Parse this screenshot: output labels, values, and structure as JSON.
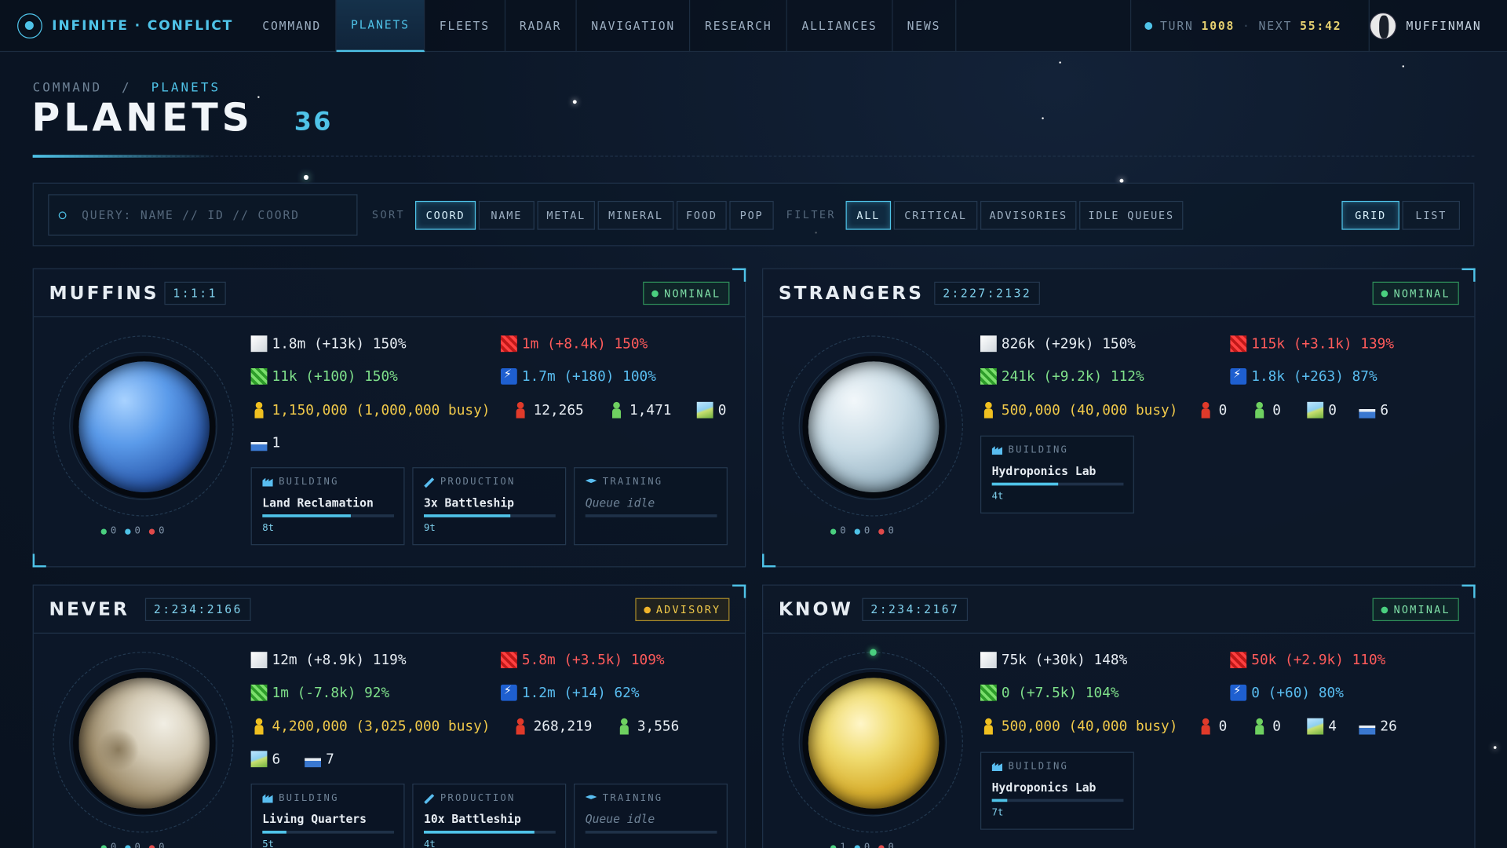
{
  "app": {
    "title": "INFINITE · CONFLICT"
  },
  "nav": {
    "tabs": [
      {
        "label": "COMMAND",
        "active": false
      },
      {
        "label": "PLANETS",
        "active": true
      },
      {
        "label": "FLEETS",
        "active": false
      },
      {
        "label": "RADAR",
        "active": false
      },
      {
        "label": "NAVIGATION",
        "active": false
      },
      {
        "label": "RESEARCH",
        "active": false
      },
      {
        "label": "ALLIANCES",
        "active": false
      },
      {
        "label": "NEWS",
        "active": false
      }
    ],
    "turn_label": "TURN",
    "turn_value": "1008",
    "next_label": "NEXT",
    "next_value": "55:42",
    "sep": "·",
    "username": "MUFFINMAN"
  },
  "breadcrumb": {
    "root": "COMMAND",
    "sep": "/",
    "current": "PLANETS"
  },
  "page": {
    "title": "PLANETS",
    "count": "36"
  },
  "toolbar": {
    "search_placeholder": "QUERY: NAME // ID // COORD",
    "sort_label": "SORT",
    "sort_options": [
      "COORD",
      "NAME",
      "METAL",
      "MINERAL",
      "FOOD",
      "POP"
    ],
    "sort_selected": "COORD",
    "filter_label": "FILTER",
    "filter_options": [
      "ALL",
      "CRITICAL",
      "ADVISORIES",
      "IDLE QUEUES"
    ],
    "filter_selected": "ALL",
    "view_options": [
      "GRID",
      "LIST"
    ],
    "view_selected": "GRID"
  },
  "colors": {
    "accent": "#4fc3e8",
    "nominal": "#4ad07f",
    "advisory": "#f0b42a",
    "negative": "#ff5b5b"
  },
  "planets": [
    {
      "name": "MUFFINS",
      "coord": "1:1:1",
      "status": "NOMINAL",
      "status_kind": "nominal",
      "metal": "1.8m (+13k) 150%",
      "mineral": "1m (+8.4k) 150%",
      "food": "11k (+100) 150%",
      "energy": "1.7m (+180) 100%",
      "population": "1,150,000 (1,000,000 busy)",
      "soldiers": "12,265",
      "workers": "1,471",
      "land": "0",
      "sea": "1",
      "moons": {
        "green": "0",
        "blue": "0",
        "red": "0"
      },
      "queues": [
        {
          "type": "BUILDING",
          "icon": "building-icon",
          "name": "Land Reclamation",
          "progress": 0.67,
          "turns": "8t"
        },
        {
          "type": "PRODUCTION",
          "icon": "hammer-icon",
          "name": "3x Battleship",
          "progress": 0.66,
          "turns": "9t"
        },
        {
          "type": "TRAINING",
          "icon": "training-icon",
          "name": "Queue idle",
          "progress": 0,
          "turns": ""
        }
      ]
    },
    {
      "name": "STRANGERS",
      "coord": "2:227:2132",
      "status": "NOMINAL",
      "status_kind": "nominal",
      "metal": "826k (+29k) 150%",
      "mineral": "115k (+3.1k) 139%",
      "food": "241k (+9.2k) 112%",
      "energy": "1.8k (+263) 87%",
      "population": "500,000 (40,000 busy)",
      "soldiers": "0",
      "workers": "0",
      "land": "0",
      "sea": "6",
      "moons": {
        "green": "0",
        "blue": "0",
        "red": "0"
      },
      "queues": [
        {
          "type": "BUILDING",
          "icon": "building-icon",
          "name": "Hydroponics Lab",
          "progress": 0.5,
          "turns": "4t"
        }
      ]
    },
    {
      "name": "NEVER",
      "coord": "2:234:2166",
      "status": "ADVISORY",
      "status_kind": "advisory",
      "metal": "12m (+8.9k) 119%",
      "mineral": "5.8m (+3.5k) 109%",
      "food": "1m (-7.8k) 92%",
      "energy": "1.2m (+14) 62%",
      "population": "4,200,000 (3,025,000 busy)",
      "soldiers": "268,219",
      "workers": "3,556",
      "land": "6",
      "sea": "7",
      "moons": {
        "green": "0",
        "blue": "0",
        "red": "0"
      },
      "queues": [
        {
          "type": "BUILDING",
          "icon": "building-icon",
          "name": "Living Quarters",
          "progress": 0.18,
          "turns": "5t"
        },
        {
          "type": "PRODUCTION",
          "icon": "hammer-icon",
          "name": "10x Battleship",
          "progress": 0.84,
          "turns": "4t"
        },
        {
          "type": "TRAINING",
          "icon": "training-icon",
          "name": "Queue idle",
          "progress": 0,
          "turns": ""
        }
      ]
    },
    {
      "name": "KNOW",
      "coord": "2:234:2167",
      "status": "NOMINAL",
      "status_kind": "nominal",
      "metal": "75k (+30k) 148%",
      "mineral": "50k (+2.9k) 110%",
      "food": "0 (+7.5k) 104%",
      "energy": "0 (+60) 80%",
      "population": "500,000 (40,000 busy)",
      "soldiers": "0",
      "workers": "0",
      "land": "4",
      "sea": "26",
      "moons": {
        "green": "1",
        "blue": "0",
        "red": "0"
      },
      "queues": [
        {
          "type": "BUILDING",
          "icon": "building-icon",
          "name": "Hydroponics Lab",
          "progress": 0.12,
          "turns": "7t"
        }
      ]
    }
  ]
}
